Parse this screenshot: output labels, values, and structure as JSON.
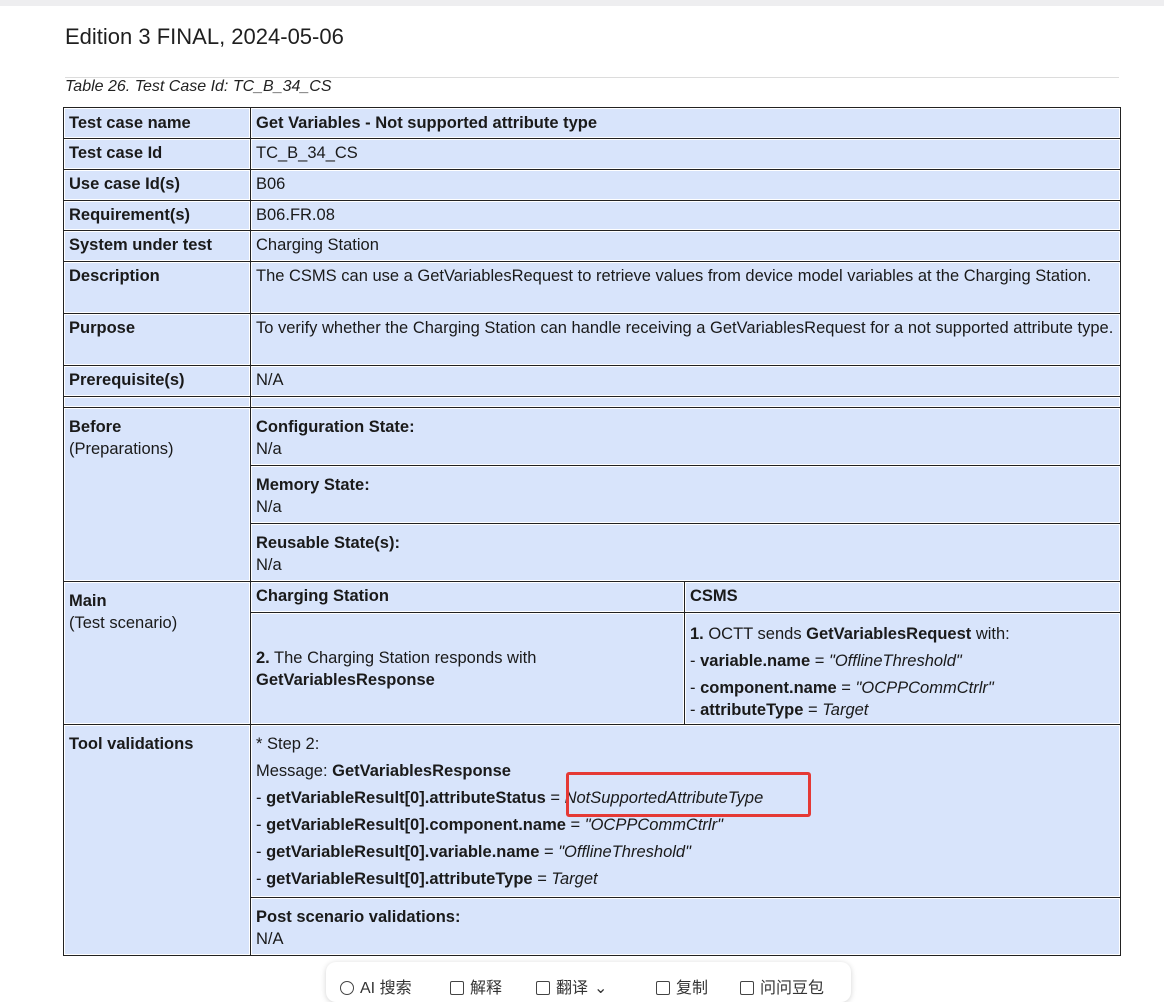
{
  "header": {
    "edition": "Edition 3 FINAL, 2024-05-06",
    "caption": "Table 26. Test Case Id: TC_B_34_CS"
  },
  "table": {
    "test_case_name": {
      "label": "Test case name",
      "value": "Get Variables - Not supported attribute type"
    },
    "test_case_id": {
      "label": "Test case Id",
      "value": "TC_B_34_CS"
    },
    "use_case": {
      "label": "Use case Id(s)",
      "value": "B06"
    },
    "requirement": {
      "label": "Requirement(s)",
      "value": "B06.FR.08"
    },
    "system_under_test": {
      "label": "System under test",
      "value": "Charging Station"
    },
    "description": {
      "label": "Description",
      "value": "The CSMS can use a GetVariablesRequest to retrieve values from device model variables at the Charging Station."
    },
    "purpose": {
      "label": "Purpose",
      "value": "To verify whether the Charging Station can handle receiving a GetVariablesRequest for a not supported attribute type."
    },
    "prerequisites": {
      "label": "Prerequisite(s)",
      "value": "N/A"
    },
    "before": {
      "label": "Before",
      "sublabel": "(Preparations)",
      "configuration_label": "Configuration State:",
      "configuration_value": "N/a",
      "memory_label": "Memory State:",
      "memory_value": "N/a",
      "reusable_label": "Reusable State(s):",
      "reusable_value": "N/a"
    },
    "main": {
      "label": "Main",
      "sublabel": "(Test scenario)",
      "col_charging_station": "Charging Station",
      "col_csms": "CSMS",
      "cs_step_num": "2.",
      "cs_step_text": " The Charging Station responds with",
      "cs_step_msg": "GetVariablesResponse",
      "csms_step_num": "1.",
      "csms_step_text": " OCTT sends ",
      "csms_step_msg": "GetVariablesRequest",
      "csms_step_with": " with:",
      "csms_lines": [
        {
          "dash": "- ",
          "key": "variable.name",
          "eq": " = ",
          "val": "\"OfflineThreshold\""
        },
        {
          "dash": "- ",
          "key": "component.name",
          "eq": " = ",
          "val": "\"OCPPCommCtrlr\""
        },
        {
          "dash": "- ",
          "key": "attributeType",
          "eq": " = ",
          "val": "Target"
        }
      ]
    },
    "tool_validations": {
      "label": "Tool validations",
      "step": "* Step 2:",
      "message_label": "Message: ",
      "message_value": "GetVariablesResponse",
      "lines": [
        {
          "dash": "- ",
          "key": "getVariableResult[0].attributeStatus",
          "eq": " = ",
          "val": "NotSupportedAttributeType"
        },
        {
          "dash": "- ",
          "key": "getVariableResult[0].component.name",
          "eq": " = ",
          "val": "\"OCPPCommCtrlr\""
        },
        {
          "dash": "- ",
          "key": "getVariableResult[0].variable.name",
          "eq": " = ",
          "val": "\"OfflineThreshold\""
        },
        {
          "dash": "- ",
          "key": "getVariableResult[0].attributeType",
          "eq": " = ",
          "val": "Target"
        }
      ],
      "post_label": "Post scenario validations:",
      "post_value": "N/A"
    }
  },
  "annotation": {
    "color": "#e53935"
  },
  "toolbar": {
    "items": [
      {
        "icon": "ai-search-icon",
        "label": "AI 搜索"
      },
      {
        "icon": "explain-icon",
        "label": "解释"
      },
      {
        "icon": "translate-icon",
        "label": "翻译"
      },
      {
        "icon": "copy-icon",
        "label": "复制"
      },
      {
        "icon": "ask-icon",
        "label": "问问豆包"
      }
    ]
  }
}
